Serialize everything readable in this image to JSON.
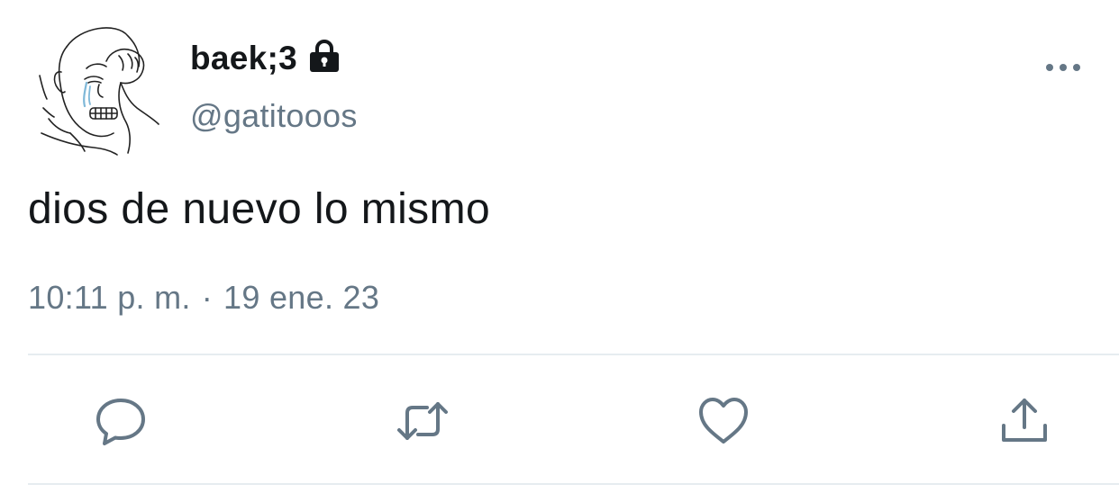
{
  "tweet": {
    "display_name": "baek;3",
    "handle": "@gatitooos",
    "text": "dios de nuevo lo mismo",
    "time": "10:11 p. m.",
    "separator": "·",
    "date": "19 ene. 23",
    "protected": true
  },
  "icons": {
    "avatar": "crying-wojak-avatar",
    "lock": "lock-icon",
    "more": "more-options-icon",
    "reply": "reply-icon",
    "retweet": "retweet-icon",
    "like": "heart-icon",
    "share": "share-icon"
  },
  "colors": {
    "text_primary": "#14171a",
    "text_secondary": "#657786",
    "divider": "#e6ecf0",
    "icon": "#657786"
  }
}
